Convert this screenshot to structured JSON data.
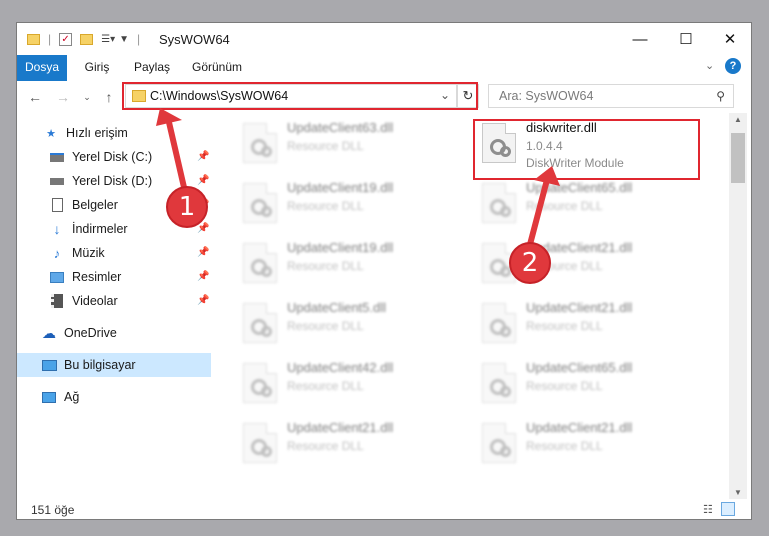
{
  "window": {
    "title": "SysWOW64",
    "controls": {
      "minimize": "—",
      "maximize": "☐",
      "close": "✕"
    }
  },
  "ribbon": {
    "tabs": [
      "Dosya",
      "Giriş",
      "Paylaş",
      "Görünüm"
    ],
    "help": "?"
  },
  "navigation": {
    "address": "C:\\Windows\\SysWOW64",
    "search_placeholder": "Ara: SysWOW64"
  },
  "sidebar": {
    "quick_access": "Hızlı erişim",
    "items": [
      {
        "label": "Yerel Disk (C:)",
        "icon": "drive-icon",
        "pinned": true
      },
      {
        "label": "Yerel Disk (D:)",
        "icon": "drive-icon",
        "pinned": true
      },
      {
        "label": "Belgeler",
        "icon": "documents-icon",
        "pinned": true
      },
      {
        "label": "İndirmeler",
        "icon": "download-icon",
        "pinned": true
      },
      {
        "label": "Müzik",
        "icon": "music-icon",
        "pinned": true
      },
      {
        "label": "Resimler",
        "icon": "pictures-icon",
        "pinned": true
      },
      {
        "label": "Videolar",
        "icon": "videos-icon",
        "pinned": true
      }
    ],
    "onedrive": "OneDrive",
    "this_pc": "Bu bilgisayar",
    "network": "Ağ"
  },
  "files": {
    "left_column": [
      {
        "name": "UpdateClient63.dll",
        "desc": "Resource DLL"
      },
      {
        "name": "UpdateClient19.dll",
        "desc": "Resource DLL"
      },
      {
        "name": "UpdateClient19.dll",
        "desc": "Resource DLL"
      },
      {
        "name": "UpdateClient5.dll",
        "desc": "Resource DLL"
      },
      {
        "name": "UpdateClient42.dll",
        "desc": "Resource DLL"
      },
      {
        "name": "UpdateClient21.dll",
        "desc": "Resource DLL"
      }
    ],
    "highlighted": {
      "name": "diskwriter.dll",
      "version": "1.0.4.4",
      "desc": "DiskWriter Module"
    },
    "right_column": [
      {
        "name": "UpdateClient65.dll",
        "desc": "Resource DLL"
      },
      {
        "name": "UpdateClient21.dll",
        "desc": "Resource DLL"
      },
      {
        "name": "UpdateClient21.dll",
        "desc": "Resource DLL"
      },
      {
        "name": "UpdateClient65.dll",
        "desc": "Resource DLL"
      },
      {
        "name": "UpdateClient21.dll",
        "desc": "Resource DLL"
      }
    ]
  },
  "status": {
    "item_count": "151 öğe"
  },
  "annotations": {
    "step1": "1",
    "step2": "2",
    "color": "#e0262f"
  }
}
